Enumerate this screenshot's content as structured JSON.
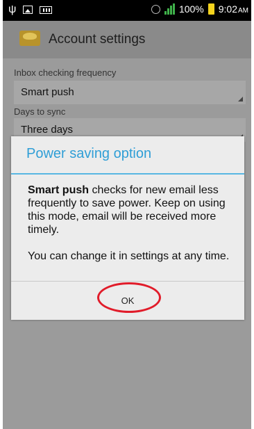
{
  "status_bar": {
    "battery_percent": "100%",
    "time": "9:02",
    "ampm": "AM",
    "icons": [
      "usb-icon",
      "image-icon",
      "keyboard-icon",
      "alarm-icon",
      "signal-icon",
      "battery-icon"
    ]
  },
  "action_bar": {
    "title": "Account settings",
    "app_icon": "email-app-icon"
  },
  "settings": {
    "inbox_label": "Inbox checking frequency",
    "inbox_value": "Smart push",
    "days_label": "Days to sync",
    "days_value": "Three days"
  },
  "dialog": {
    "title": "Power saving option",
    "body_bold": "Smart push",
    "body_rest": " checks for new email less frequently to save power. Keep on using this mode, email will be received more timely.",
    "body_2": "You can change it in settings at any time.",
    "ok_label": "OK"
  },
  "colors": {
    "dialog_title": "#2f9ed6",
    "highlight": "#e11c2a",
    "battery": "#f3d21d",
    "signal": "#3fb24a"
  }
}
